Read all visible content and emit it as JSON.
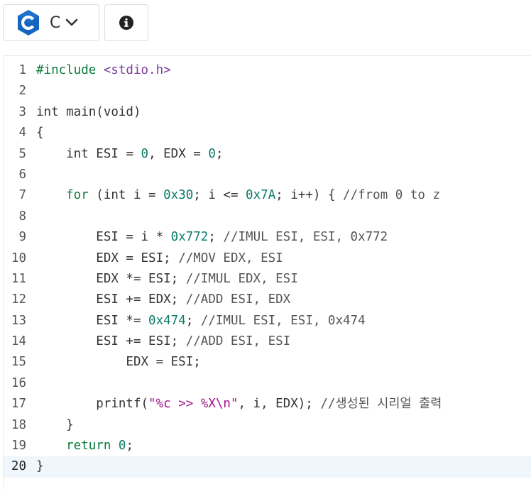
{
  "toolbar": {
    "language_label": "C",
    "language_icon": "c-language-icon",
    "dropdown_icon": "chevron-down-icon",
    "info_icon": "info-icon"
  },
  "editor": {
    "active_line": 20,
    "lines": [
      {
        "num": "1",
        "tokens": [
          {
            "t": "#include ",
            "c": "pp"
          },
          {
            "t": "<stdio.h>",
            "c": "inc"
          }
        ]
      },
      {
        "num": "2",
        "tokens": []
      },
      {
        "num": "3",
        "tokens": [
          {
            "t": "int",
            "c": "ty"
          },
          {
            "t": " main(void)",
            "c": ""
          }
        ]
      },
      {
        "num": "4",
        "tokens": [
          {
            "t": "{",
            "c": ""
          }
        ]
      },
      {
        "num": "5",
        "tokens": [
          {
            "t": "    int",
            "c": "ty"
          },
          {
            "t": " ESI = ",
            "c": ""
          },
          {
            "t": "0",
            "c": "num"
          },
          {
            "t": ", EDX = ",
            "c": ""
          },
          {
            "t": "0",
            "c": "num"
          },
          {
            "t": ";",
            "c": ""
          }
        ]
      },
      {
        "num": "6",
        "tokens": []
      },
      {
        "num": "7",
        "tokens": [
          {
            "t": "    for",
            "c": "kw"
          },
          {
            "t": " (int i = ",
            "c": ""
          },
          {
            "t": "0x30",
            "c": "num"
          },
          {
            "t": "; i <= ",
            "c": ""
          },
          {
            "t": "0x7A",
            "c": "num"
          },
          {
            "t": "; i++) { ",
            "c": ""
          },
          {
            "t": "//from 0 to z",
            "c": "cm"
          }
        ]
      },
      {
        "num": "8",
        "tokens": []
      },
      {
        "num": "9",
        "tokens": [
          {
            "t": "        ESI = i * ",
            "c": ""
          },
          {
            "t": "0x772",
            "c": "num"
          },
          {
            "t": "; ",
            "c": ""
          },
          {
            "t": "//IMUL ESI, ESI, 0x772",
            "c": "cm"
          }
        ]
      },
      {
        "num": "10",
        "tokens": [
          {
            "t": "        EDX = ESI; ",
            "c": ""
          },
          {
            "t": "//MOV EDX, ESI",
            "c": "cm"
          }
        ]
      },
      {
        "num": "11",
        "tokens": [
          {
            "t": "        EDX *= ESI; ",
            "c": ""
          },
          {
            "t": "//IMUL EDX, ESI",
            "c": "cm"
          }
        ]
      },
      {
        "num": "12",
        "tokens": [
          {
            "t": "        ESI += EDX; ",
            "c": ""
          },
          {
            "t": "//ADD ESI, EDX",
            "c": "cm"
          }
        ]
      },
      {
        "num": "13",
        "tokens": [
          {
            "t": "        ESI *= ",
            "c": ""
          },
          {
            "t": "0x474",
            "c": "num"
          },
          {
            "t": "; ",
            "c": ""
          },
          {
            "t": "//IMUL ESI, ESI, 0x474",
            "c": "cm"
          }
        ]
      },
      {
        "num": "14",
        "tokens": [
          {
            "t": "        ESI += ESI; ",
            "c": ""
          },
          {
            "t": "//ADD ESI, ESI",
            "c": "cm"
          }
        ]
      },
      {
        "num": "15",
        "tokens": [
          {
            "t": "            EDX = ESI;",
            "c": ""
          }
        ]
      },
      {
        "num": "16",
        "tokens": []
      },
      {
        "num": "17",
        "tokens": [
          {
            "t": "        printf(",
            "c": ""
          },
          {
            "t": "\"%c >> %X\\n\"",
            "c": "str"
          },
          {
            "t": ", i, EDX); ",
            "c": ""
          },
          {
            "t": "//생성된 시리얼 출력",
            "c": "cm"
          }
        ]
      },
      {
        "num": "18",
        "tokens": [
          {
            "t": "    }",
            "c": ""
          }
        ]
      },
      {
        "num": "19",
        "tokens": [
          {
            "t": "    return",
            "c": "kw"
          },
          {
            "t": " ",
            "c": ""
          },
          {
            "t": "0",
            "c": "num"
          },
          {
            "t": ";",
            "c": ""
          }
        ]
      },
      {
        "num": "20",
        "tokens": [
          {
            "t": "}",
            "c": ""
          }
        ]
      }
    ]
  }
}
